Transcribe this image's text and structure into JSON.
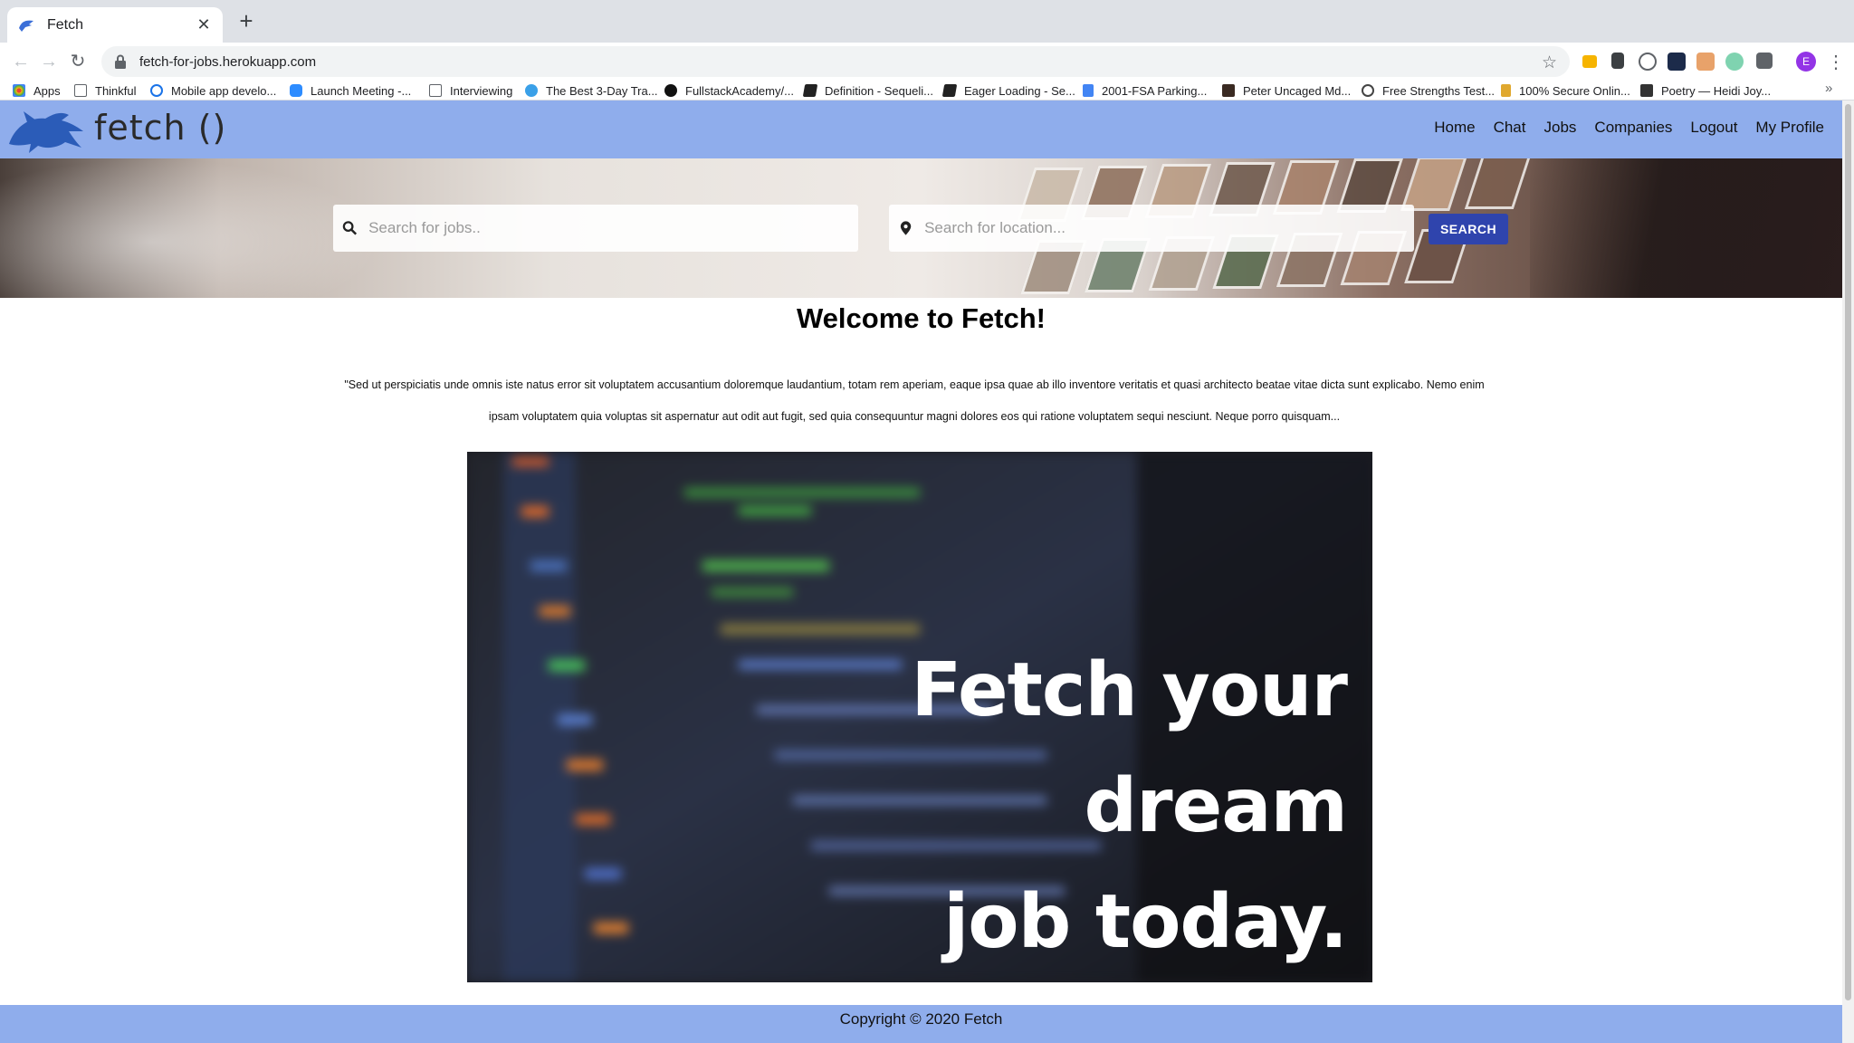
{
  "browser": {
    "tab_title": "Fetch",
    "new_tab_symbol": "+",
    "url": "fetch-for-jobs.herokuapp.com",
    "profile_initial": "E",
    "bookmarks": [
      {
        "label": "Apps",
        "icon": "apps-grid-icon",
        "color": "#ea4335"
      },
      {
        "label": "Thinkful",
        "icon": "folder-icon",
        "color": "#5f6368"
      },
      {
        "label": "Mobile app develo...",
        "icon": "gear-icon",
        "color": "#1a73e8"
      },
      {
        "label": "Launch Meeting -...",
        "icon": "video-icon",
        "color": "#2d8cff"
      },
      {
        "label": "Interviewing",
        "icon": "folder-icon",
        "color": "#5f6368"
      },
      {
        "label": "The Best 3-Day Tra...",
        "icon": "site-icon",
        "color": "#3aa0e8"
      },
      {
        "label": "FullstackAcademy/...",
        "icon": "github-icon",
        "color": "#111111"
      },
      {
        "label": "Definition - Sequeli...",
        "icon": "book-icon",
        "color": "#222222"
      },
      {
        "label": "Eager Loading - Se...",
        "icon": "book-icon",
        "color": "#222222"
      },
      {
        "label": "2001-FSA Parking...",
        "icon": "doc-icon",
        "color": "#4285f4"
      },
      {
        "label": "Peter Uncaged Md...",
        "icon": "image-icon",
        "color": "#3a2a22"
      },
      {
        "label": "Free Strengths Test...",
        "icon": "globe-icon",
        "color": "#444444"
      },
      {
        "label": "100% Secure Onlin...",
        "icon": "lock-icon",
        "color": "#e0a82e"
      },
      {
        "label": "Poetry — Heidi Joy...",
        "icon": "cube-icon",
        "color": "#333333"
      }
    ]
  },
  "site": {
    "logo_text": "fetch ()",
    "nav": [
      "Home",
      "Chat",
      "Jobs",
      "Companies",
      "Logout",
      "My Profile"
    ],
    "search": {
      "jobs_placeholder": "Search for jobs..",
      "location_placeholder": "Search for location...",
      "button_label": "SEARCH"
    },
    "welcome_title": "Welcome to Fetch!",
    "lorem_text": "\"Sed ut perspiciatis unde omnis iste natus error sit voluptatem accusantium doloremque laudantium, totam rem aperiam, eaque ipsa quae ab illo inventore veritatis et quasi architecto beatae vitae dicta sunt explicabo. Nemo enim ipsam voluptatem quia voluptas sit aspernatur aut odit aut fugit, sed quia consequuntur magni dolores eos qui ratione voluptatem sequi nesciunt. Neque porro quisquam...",
    "banner_line1": "Fetch your dream",
    "banner_line2": "job today.",
    "footer": "Copyright © 2020 Fetch"
  },
  "colors": {
    "navbar": "#8fadec",
    "search_button": "#2f44ad",
    "footer": "#8fadec"
  }
}
